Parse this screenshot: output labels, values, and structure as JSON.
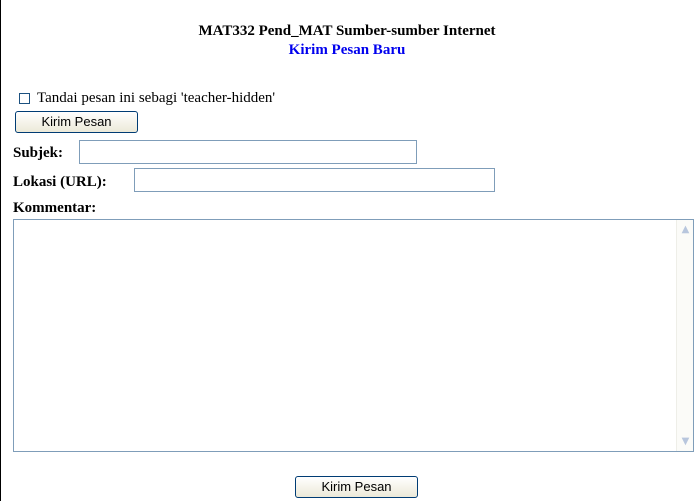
{
  "header": {
    "title": "MAT332 Pend_MAT Sumber-sumber Internet",
    "subtitle": "Kirim Pesan Baru"
  },
  "form": {
    "hidden_checkbox_label": "Tandai pesan ini sebagi 'teacher-hidden'",
    "hidden_checkbox_checked": false,
    "submit_label_top": "Kirim Pesan",
    "subject_label": "Subjek:",
    "subject_value": "",
    "location_label": "Lokasi (URL):",
    "location_value": "",
    "comment_label": "Kommentar:",
    "comment_value": "",
    "submit_label_bottom": "Kirim Pesan"
  },
  "icons": {
    "scroll_up": "scroll-up-arrow-icon",
    "scroll_down": "scroll-down-arrow-icon"
  },
  "colors": {
    "subtitle": "#0000ee",
    "button_border": "#003c74",
    "input_border": "#7f9db9"
  }
}
